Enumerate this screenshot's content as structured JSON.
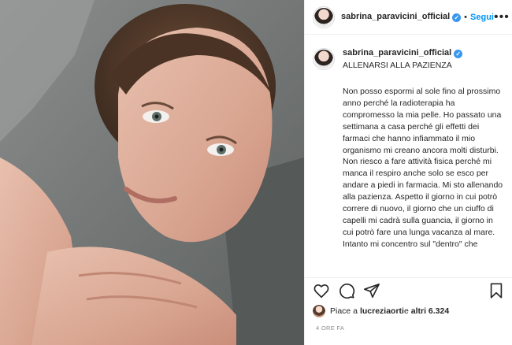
{
  "post": {
    "username": "sabrina_paravicini_official",
    "verified_icon": "verified-badge-icon",
    "separator": "•",
    "follow_label": "Segui",
    "more_label": "•••"
  },
  "caption": {
    "username": "sabrina_paravicini_official",
    "title": "ALLENARSI ALLA PAZIENZA",
    "text": "Non posso espormi al sole fino al prossimo anno perché la radioterapia ha compromesso la mia pelle. Ho passato una settimana a casa perché gli effetti dei farmaci che hanno infiammato il mio organismo mi creano ancora molti disturbi. Non riesco a fare attività fisica perché mi manca il respiro anche solo se esco per andare a piedi in farmacia. Mi sto allenando alla pazienza. Aspetto il giorno in cui potrò correre di nuovo, il giorno che un ciuffo di capelli mi cadrà sulla guancia, il giorno in cui potrò fare una lunga vacanza al mare.\nIntanto mi concentro sul \"dentro\" che"
  },
  "actions": {
    "like_icon": "heart-icon",
    "comment_icon": "comment-icon",
    "share_icon": "share-icon",
    "save_icon": "bookmark-icon"
  },
  "likes": {
    "prefix": "Piace a ",
    "user": "lucreziaorti",
    "middle": " e ",
    "count": "altri 6.324"
  },
  "timestamp": "4 ORE FA",
  "colors": {
    "accent": "#0095f6",
    "verified": "#3897f0",
    "muted": "#8e8e8e"
  }
}
